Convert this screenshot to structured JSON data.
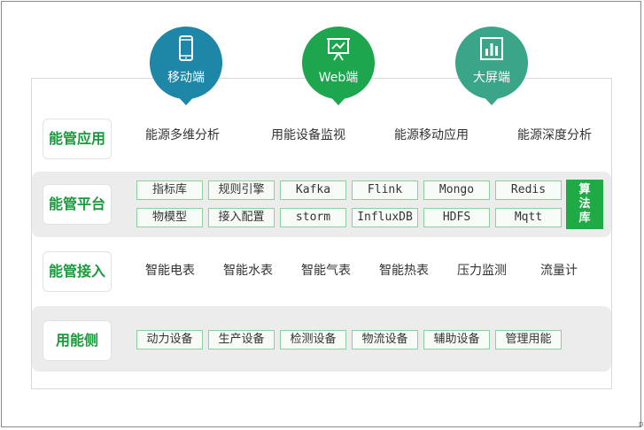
{
  "clients": [
    {
      "label": "移动端",
      "icon": "mobile-phone-icon",
      "color": "#1e86a6"
    },
    {
      "label": "Web端",
      "icon": "presentation-board-icon",
      "color": "#1ea64e"
    },
    {
      "label": "大屏端",
      "icon": "bar-chart-screen-icon",
      "color": "#3aa589"
    }
  ],
  "layers": {
    "application": {
      "title": "能管应用",
      "items": [
        "能源多维分析",
        "用能设备监视",
        "能源移动应用",
        "能源深度分析"
      ]
    },
    "platform": {
      "title": "能管平台",
      "row1": [
        "指标库",
        "规则引擎",
        "Kafka",
        "Flink",
        "Mongo",
        "Redis"
      ],
      "row2": [
        "物模型",
        "接入配置",
        "storm",
        "InfluxDB",
        "HDFS",
        "Mqtt"
      ],
      "algorithm": [
        "算",
        "法",
        "库"
      ]
    },
    "access": {
      "title": "能管接入",
      "items": [
        "智能电表",
        "智能水表",
        "智能气表",
        "智能热表",
        "压力监测",
        "流量计"
      ]
    },
    "device": {
      "title": "用能侧",
      "items": [
        "动力设备",
        "生产设备",
        "检测设备",
        "物流设备",
        "辅助设备",
        "管理用能"
      ]
    }
  },
  "colors": {
    "accent_green": "#1a9a3c",
    "tag_border": "#8ecf9e",
    "algo_bg": "#1faa46",
    "row_bg": "#ececec"
  },
  "corner_mark": "D"
}
